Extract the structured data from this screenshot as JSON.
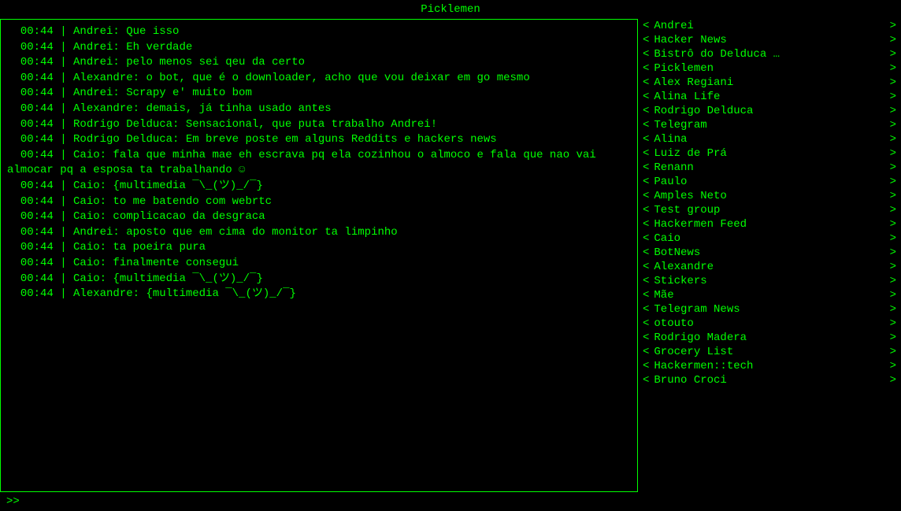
{
  "header": {
    "title": "Picklemen"
  },
  "chat": {
    "messages": "  00:44 | Andrei: Que isso\n  00:44 | Andrei: Eh verdade\n  00:44 | Andrei: pelo menos sei qeu da certo\n  00:44 | Alexandre: o bot, que é o downloader, acho que vou deixar em go mesmo\n  00:44 | Andrei: Scrapy e' muito bom\n  00:44 | Alexandre: demais, já tinha usado antes\n  00:44 | Rodrigo Delduca: Sensacional, que puta trabalho Andrei!\n  00:44 | Rodrigo Delduca: Em breve poste em alguns Reddits e hackers news\n  00:44 | Caio: fala que minha mae eh escrava pq ela cozinhou o almoco e fala que nao vai almocar pq a esposa ta trabalhando ☺\n  00:44 | Caio: {multimedia ¯\\_(ツ)_/¯}\n  00:44 | Caio: to me batendo com webrtc\n  00:44 | Caio: complicacao da desgraca\n  00:44 | Andrei: aposto que em cima do monitor ta limpinho\n  00:44 | Caio: ta poeira pura\n  00:44 | Caio: finalmente consegui\n  00:44 | Caio: {multimedia ¯\\_(ツ)_/¯}\n  00:44 | Alexandre: {multimedia ¯\\_(ツ)_/¯}"
  },
  "input_prompt": ">>",
  "sidebar": {
    "items": [
      {
        "name": "Andrei"
      },
      {
        "name": "Hacker News"
      },
      {
        "name": "Bistrô do Delduca …"
      },
      {
        "name": "Picklemen"
      },
      {
        "name": "Alex Regiani"
      },
      {
        "name": "Alina Life"
      },
      {
        "name": "Rodrigo Delduca"
      },
      {
        "name": "Telegram"
      },
      {
        "name": "Alina"
      },
      {
        "name": "Luiz de Prá"
      },
      {
        "name": "Renann"
      },
      {
        "name": "Paulo"
      },
      {
        "name": "Amples Neto"
      },
      {
        "name": "Test group"
      },
      {
        "name": "Hackermen Feed"
      },
      {
        "name": "Caio"
      },
      {
        "name": "BotNews"
      },
      {
        "name": "Alexandre"
      },
      {
        "name": "Stickers"
      },
      {
        "name": "Mãe"
      },
      {
        "name": "Telegram News"
      },
      {
        "name": "otouto"
      },
      {
        "name": "Rodrigo Madera"
      },
      {
        "name": "Grocery List"
      },
      {
        "name": "Hackermen::tech"
      },
      {
        "name": "Bruno Croci"
      }
    ]
  }
}
